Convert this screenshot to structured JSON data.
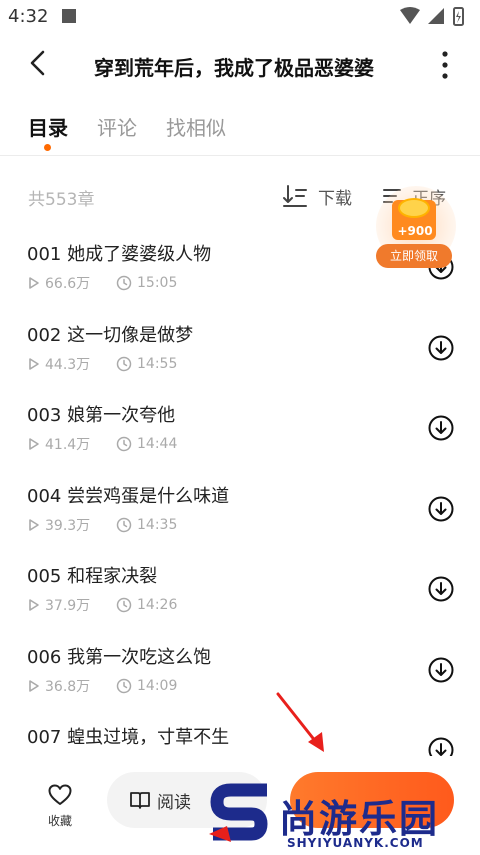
{
  "status": {
    "time": "4:32"
  },
  "header": {
    "title": "穿到荒年后，我成了极品恶婆婆"
  },
  "tabs": [
    {
      "label": "目录"
    },
    {
      "label": "评论"
    },
    {
      "label": "找相似"
    }
  ],
  "list_header": {
    "count": "共553章",
    "download_label": "下载",
    "sort_label": "正序"
  },
  "chapters": [
    {
      "title": "001 她成了婆婆级人物",
      "plays": "66.6万",
      "duration": "15:05"
    },
    {
      "title": "002 这一切像是做梦",
      "plays": "44.3万",
      "duration": "14:55"
    },
    {
      "title": "003 娘第一次夸他",
      "plays": "41.4万",
      "duration": "14:44"
    },
    {
      "title": "004 尝尝鸡蛋是什么味道",
      "plays": "39.3万",
      "duration": "14:35"
    },
    {
      "title": "005 和程家决裂",
      "plays": "37.9万",
      "duration": "14:26"
    },
    {
      "title": "006 我第一次吃这么饱",
      "plays": "36.8万",
      "duration": "14:09"
    },
    {
      "title": "007 蝗虫过境，寸草不生",
      "plays": "",
      "duration": ""
    }
  ],
  "reward": {
    "amount": "+900",
    "button": "立即领取"
  },
  "bottom_bar": {
    "favorite_label": "收藏",
    "read_label": "阅读"
  },
  "watermark": {
    "brand": "尚游乐园",
    "url": "SHYIYUANYK.COM"
  },
  "colors": {
    "accent": "#ff6a00",
    "watermark": "#1d2b8c"
  }
}
